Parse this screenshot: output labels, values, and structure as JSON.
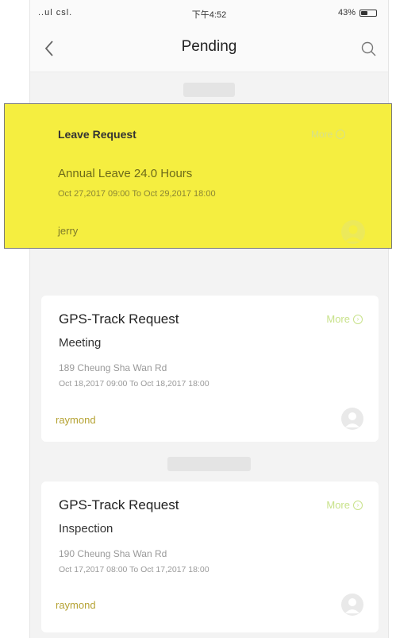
{
  "status_bar": {
    "carrier": "..ul csl.",
    "time": "下午4:52",
    "battery_text": "43%",
    "battery_level": 0.43
  },
  "nav": {
    "back_icon": "chevron-left-icon",
    "title": "Pending",
    "search_icon": "search-icon"
  },
  "highlighted_request": {
    "type": "Leave Request",
    "more": "More",
    "detail": "Annual Leave 24.0 Hours",
    "time_range": "Oct 27,2017 09:00 To Oct 29,2017 18:00",
    "user": "jerry"
  },
  "requests": [
    {
      "type": "GPS-Track Request",
      "more": "More",
      "purpose": "Meeting",
      "address": "189 Cheung Sha Wan Rd",
      "time_range": "Oct 18,2017 09:00 To Oct 18,2017 18:00",
      "user": "raymond"
    },
    {
      "type": "GPS-Track Request",
      "more": "More",
      "purpose": "Inspection",
      "address": "190 Cheung Sha Wan Rd",
      "time_range": "Oct 17,2017 08:00 To Oct 17,2017 18:00",
      "user": "raymond"
    }
  ],
  "colors": {
    "highlight": "#f5ee40",
    "more_link": "#c8e28a",
    "user_name": "#b5a233",
    "background": "#f3f3f3"
  }
}
